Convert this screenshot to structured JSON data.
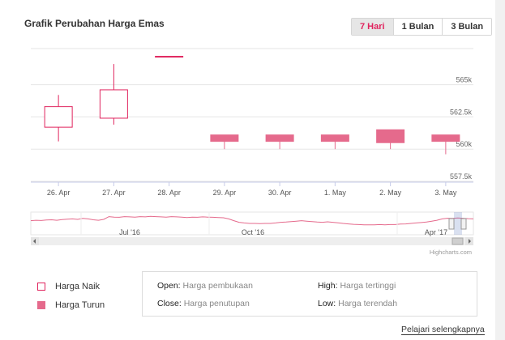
{
  "title": "Grafik Perubahan Harga Emas",
  "range_buttons": [
    {
      "label": "7 Hari",
      "active": true
    },
    {
      "label": "1 Bulan",
      "active": false
    },
    {
      "label": "3 Bulan",
      "active": false
    }
  ],
  "colors": {
    "accent": "#e0245e",
    "up_border": "#e0245e",
    "down_fill": "#e56a8c",
    "grid": "#e6e6e6"
  },
  "chart_data": {
    "type": "candlestick",
    "categories": [
      "26. Apr",
      "27. Apr",
      "28. Apr",
      "29. Apr",
      "30. Apr",
      "1. May",
      "2. May",
      "3. May"
    ],
    "ohlc": [
      {
        "open": 561.7,
        "high": 564.2,
        "low": 560.6,
        "close": 563.3
      },
      {
        "open": 562.4,
        "high": 566.6,
        "low": 561.9,
        "close": 564.6
      },
      {
        "open": 567.2,
        "high": 567.2,
        "low": 567.2,
        "close": 567.2
      },
      {
        "open": 561.1,
        "high": 561.1,
        "low": 560.0,
        "close": 560.6
      },
      {
        "open": 561.1,
        "high": 561.1,
        "low": 560.0,
        "close": 560.6
      },
      {
        "open": 561.1,
        "high": 561.1,
        "low": 560.0,
        "close": 560.6
      },
      {
        "open": 561.5,
        "high": 561.5,
        "low": 560.0,
        "close": 560.5
      },
      {
        "open": 561.1,
        "high": 561.1,
        "low": 559.6,
        "close": 560.6
      }
    ],
    "y_ticks": [
      {
        "value": 557.5,
        "label": "557.5k"
      },
      {
        "value": 560,
        "label": "560k"
      },
      {
        "value": 562.5,
        "label": "562.5k"
      },
      {
        "value": 565,
        "label": "565k"
      }
    ],
    "ylim": [
      557.5,
      567.8
    ],
    "grid": true,
    "navigator": {
      "labels": [
        "Jul '16",
        "Oct '16",
        "Apr '17"
      ],
      "series": [
        0.62,
        0.64,
        0.63,
        0.65,
        0.66,
        0.64,
        0.67,
        0.69,
        0.7,
        0.68,
        0.72,
        0.7,
        0.66,
        0.64,
        0.68,
        0.8,
        0.78,
        0.77,
        0.8,
        0.79,
        0.78,
        0.8,
        0.79,
        0.81,
        0.8,
        0.79,
        0.78,
        0.8,
        0.79,
        0.78,
        0.76,
        0.78,
        0.77,
        0.79,
        0.78,
        0.77,
        0.76,
        0.75,
        0.7,
        0.62,
        0.55,
        0.52,
        0.5,
        0.5,
        0.49,
        0.5,
        0.5,
        0.52,
        0.55,
        0.56,
        0.58,
        0.6,
        0.62,
        0.6,
        0.58,
        0.56,
        0.55,
        0.57,
        0.55,
        0.53,
        0.5,
        0.48,
        0.46,
        0.45,
        0.44,
        0.44,
        0.44,
        0.45,
        0.44,
        0.45,
        0.45,
        0.47,
        0.48,
        0.5,
        0.52,
        0.54,
        0.56,
        0.6,
        0.64,
        0.7,
        0.73,
        0.72,
        0.74,
        0.73,
        0.71,
        0.7
      ]
    },
    "credit": "Highcharts.com"
  },
  "legend": [
    {
      "label": "Harga Naik",
      "kind": "up"
    },
    {
      "label": "Harga Turun",
      "kind": "down"
    }
  ],
  "info": {
    "open_key": "Open:",
    "open_val": "Harga pembukaan",
    "close_key": "Close:",
    "close_val": "Harga penutupan",
    "high_key": "High:",
    "high_val": "Harga tertinggi",
    "low_key": "Low:",
    "low_val": "Harga terendah"
  },
  "learn_more": "Pelajari selengkapnya"
}
